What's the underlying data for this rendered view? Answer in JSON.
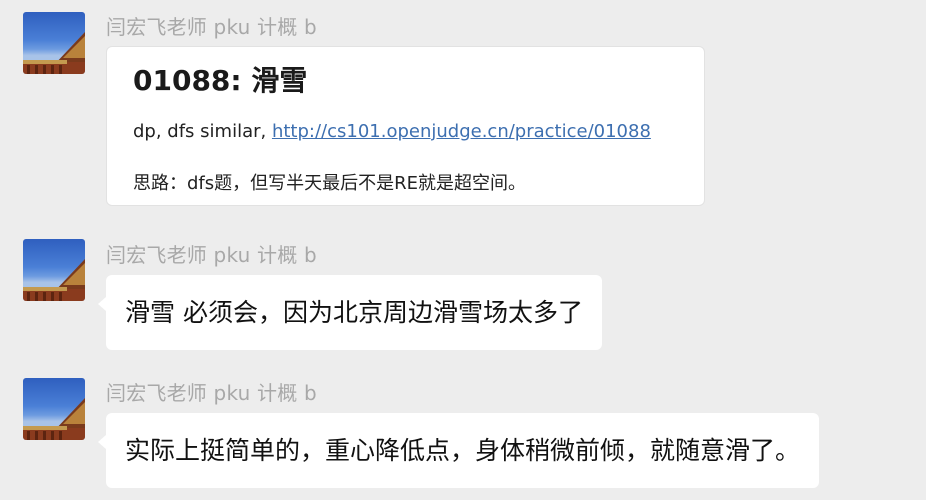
{
  "messages": [
    {
      "sender": "闫宏飞老师 pku 计概 b",
      "card": {
        "title": "01088: 滑雪",
        "line1_prefix": "dp, dfs similar, ",
        "link": "http://cs101.openjudge.cn/practice/01088",
        "line2": "思路：dfs题，但写半天最后不是RE就是超空间。"
      }
    },
    {
      "sender": "闫宏飞老师 pku 计概 b",
      "text": "滑雪 必须会，因为北京周边滑雪场太多了"
    },
    {
      "sender": "闫宏飞老师 pku 计概 b",
      "text": "实际上挺简单的，重心降低点，身体稍微前倾，就随意滑了。"
    }
  ],
  "avatar": {
    "icon": "forbidden-city-avatar-icon",
    "sky_color": "#3a6cc8",
    "building_color": "#8a3b1e"
  }
}
